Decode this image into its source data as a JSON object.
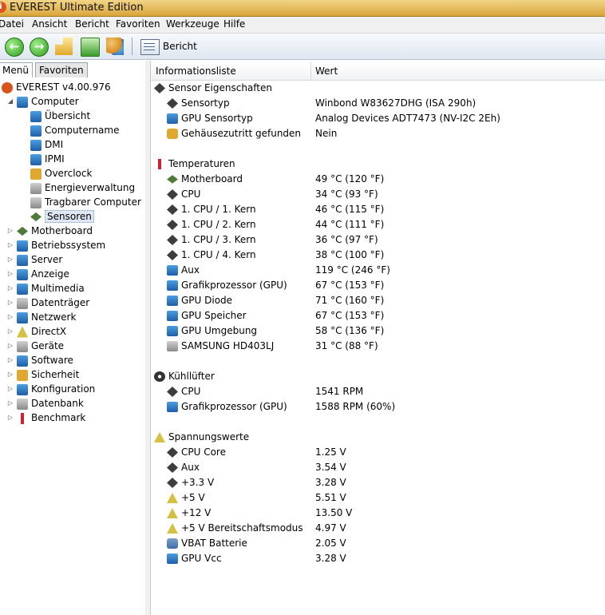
{
  "window": {
    "title": "EVEREST Ultimate Edition"
  },
  "menu": [
    "Datei",
    "Ansicht",
    "Bericht",
    "Favoriten",
    "Werkzeuge",
    "Hilfe"
  ],
  "toolbar": {
    "report_label": "Bericht"
  },
  "tabs": {
    "menu": "Menü",
    "favorites": "Favoriten"
  },
  "tree": {
    "root": "EVEREST v4.00.976",
    "computer": "Computer",
    "computer_children": [
      "Übersicht",
      "Computername",
      "DMI",
      "IPMI",
      "Overclock",
      "Energieverwaltung",
      "Tragbarer Computer",
      "Sensoren"
    ],
    "categories": [
      "Motherboard",
      "Betriebssystem",
      "Server",
      "Anzeige",
      "Multimedia",
      "Datenträger",
      "Netzwerk",
      "DirectX",
      "Geräte",
      "Software",
      "Sicherheit",
      "Konfiguration",
      "Datenbank",
      "Benchmark"
    ]
  },
  "table": {
    "col_field": "Informationsliste",
    "col_value": "Wert",
    "sections": [
      {
        "title": "Sensor Eigenschaften",
        "icon": "sensor-icon",
        "rows": [
          {
            "label": "Sensortyp",
            "value": "Winbond W83627DHG  (ISA 290h)",
            "icon": "chip-icon"
          },
          {
            "label": "GPU Sensortyp",
            "value": "Analog Devices ADT7473  (NV-I2C 2Eh)",
            "icon": "monitor-icon"
          },
          {
            "label": "Gehäusezutritt gefunden",
            "value": "Nein",
            "icon": "lock-icon"
          }
        ]
      },
      {
        "title": "Temperaturen",
        "icon": "thermometer-icon",
        "rows": [
          {
            "label": "Motherboard",
            "value": "49 °C  (120 °F)",
            "icon": "board-icon"
          },
          {
            "label": "CPU",
            "value": "34 °C  (93 °F)",
            "icon": "chip-icon"
          },
          {
            "label": "1. CPU / 1. Kern",
            "value": "46 °C  (115 °F)",
            "icon": "chip-icon"
          },
          {
            "label": "1. CPU / 2. Kern",
            "value": "44 °C  (111 °F)",
            "icon": "chip-icon"
          },
          {
            "label": "1. CPU / 3. Kern",
            "value": "36 °C  (97 °F)",
            "icon": "chip-icon"
          },
          {
            "label": "1. CPU / 4. Kern",
            "value": "38 °C  (100 °F)",
            "icon": "chip-icon"
          },
          {
            "label": "Aux",
            "value": "119 °C  (246 °F)",
            "icon": "monitor-icon"
          },
          {
            "label": "Grafikprozessor (GPU)",
            "value": "67 °C  (153 °F)",
            "icon": "monitor-icon"
          },
          {
            "label": "GPU Diode",
            "value": "71 °C  (160 °F)",
            "icon": "monitor-icon"
          },
          {
            "label": "GPU Speicher",
            "value": "67 °C  (153 °F)",
            "icon": "monitor-icon"
          },
          {
            "label": "GPU Umgebung",
            "value": "58 °C  (136 °F)",
            "icon": "monitor-icon"
          },
          {
            "label": "SAMSUNG HD403LJ",
            "value": "31 °C  (88 °F)",
            "icon": "hdd-icon"
          }
        ]
      },
      {
        "title": "Kühllüfter",
        "icon": "fan-icon",
        "rows": [
          {
            "label": "CPU",
            "value": "1541 RPM",
            "icon": "chip-icon"
          },
          {
            "label": "Grafikprozessor (GPU)",
            "value": "1588 RPM  (60%)",
            "icon": "monitor-icon"
          }
        ]
      },
      {
        "title": "Spannungswerte",
        "icon": "warning-icon",
        "rows": [
          {
            "label": "CPU Core",
            "value": "1.25 V",
            "icon": "chip-icon"
          },
          {
            "label": "Aux",
            "value": "3.54 V",
            "icon": "chip-icon"
          },
          {
            "label": "+3.3 V",
            "value": "3.28 V",
            "icon": "chip-icon"
          },
          {
            "label": "+5 V",
            "value": "5.51 V",
            "icon": "warning-icon"
          },
          {
            "label": "+12 V",
            "value": "13.50 V",
            "icon": "warning-icon"
          },
          {
            "label": "+5 V Bereitschaftsmodus",
            "value": "4.97 V",
            "icon": "warning-icon"
          },
          {
            "label": "VBAT Batterie",
            "value": "2.05 V",
            "icon": "battery-icon"
          },
          {
            "label": "GPU Vcc",
            "value": "3.28 V",
            "icon": "monitor-icon"
          }
        ]
      }
    ]
  }
}
